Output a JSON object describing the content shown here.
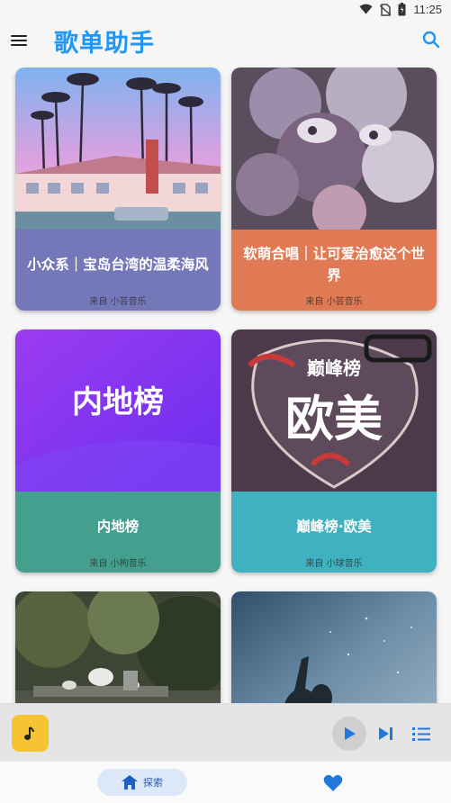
{
  "status_bar": {
    "time": "11:25"
  },
  "app_bar": {
    "title": "歌单助手"
  },
  "playlists": [
    {
      "title": "小众系｜宝岛台湾的温柔海风",
      "source": "来自 小芸音乐",
      "info_color": "#7478b9"
    },
    {
      "title": "软萌合唱｜让可爱治愈这个世界",
      "source": "来自 小芸音乐",
      "info_color": "#e07a55"
    },
    {
      "title": "内地榜",
      "source": "来自 小枸音乐",
      "info_color": "#449f8f",
      "cover_text": "内地榜"
    },
    {
      "title": "巅峰榜·欧美",
      "source": "来自 小球音乐",
      "info_color": "#3fb1c1",
      "cover_text_top": "巅峰榜",
      "cover_text_main": "欧美"
    },
    {
      "title": "",
      "source": "",
      "info_color": "#ffffff"
    },
    {
      "title": "",
      "source": "",
      "info_color": "#ffffff"
    }
  ],
  "bottom_nav": {
    "explore_label": "探索"
  },
  "colors": {
    "accent": "#2196f3",
    "player_art": "#f6c332",
    "nav_pill": "#dce8f8",
    "heart": "#2277dd"
  },
  "icons": [
    "menu-icon",
    "search-icon",
    "wifi-icon",
    "no-sim-icon",
    "battery-icon",
    "music-note-icon",
    "play-icon",
    "skip-next-icon",
    "playlist-icon",
    "home-icon",
    "heart-icon"
  ]
}
